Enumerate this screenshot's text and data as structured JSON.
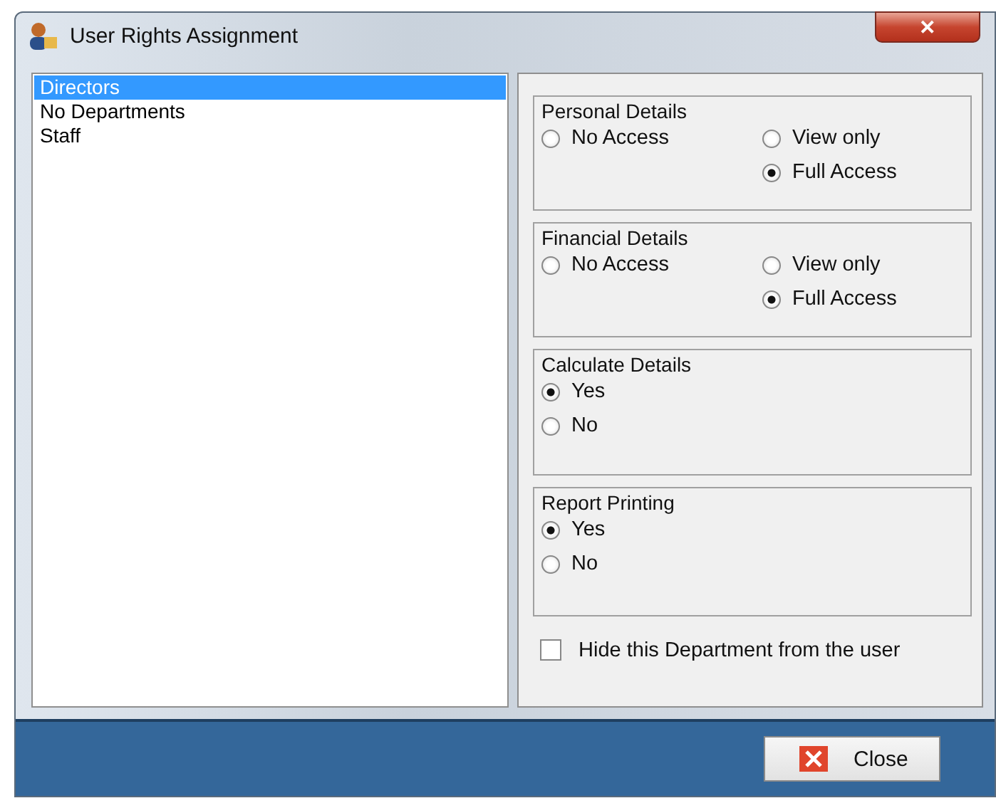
{
  "window": {
    "title": "User Rights Assignment",
    "close_glyph": "✕"
  },
  "departments": [
    {
      "label": "Directors",
      "selected": true
    },
    {
      "label": "No Departments",
      "selected": false
    },
    {
      "label": "Staff",
      "selected": false
    }
  ],
  "groups": [
    {
      "title": "Personal Details",
      "options": [
        {
          "label": "No Access",
          "selected": false
        },
        {
          "label": "View only",
          "selected": false
        },
        {
          "label": "Full Access",
          "selected": true
        }
      ]
    },
    {
      "title": "Financial Details",
      "options": [
        {
          "label": "No Access",
          "selected": false
        },
        {
          "label": "View only",
          "selected": false
        },
        {
          "label": "Full Access",
          "selected": true
        }
      ]
    },
    {
      "title": "Calculate Details",
      "options": [
        {
          "label": "Yes",
          "selected": true
        },
        {
          "label": "No",
          "selected": false
        }
      ]
    },
    {
      "title": "Report Printing",
      "options": [
        {
          "label": "Yes",
          "selected": true
        },
        {
          "label": "No",
          "selected": false
        }
      ]
    }
  ],
  "hide_department": {
    "label": "Hide this Department from the user",
    "checked": false
  },
  "close_button": {
    "label": "Close"
  }
}
